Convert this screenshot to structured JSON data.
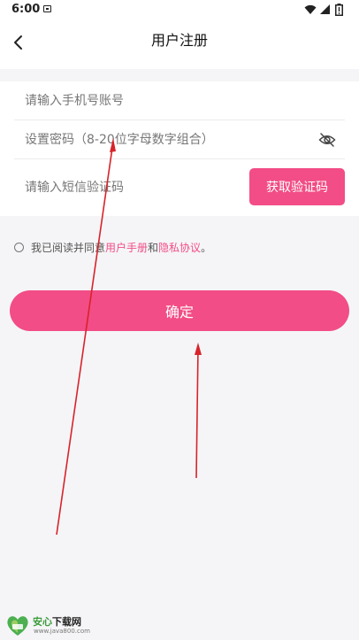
{
  "status_bar": {
    "time": "6:00",
    "icons": [
      "notification-icon",
      "wifi-icon",
      "signal-icon",
      "battery-icon"
    ]
  },
  "header": {
    "title": "用户注册",
    "back_icon": "chevron-left-icon"
  },
  "form": {
    "phone_placeholder": "请输入手机号账号",
    "password_placeholder": "设置密码（8-20位字母数字组合）",
    "password_visibility_icon": "eye-off-icon",
    "sms_placeholder": "请输入短信验证码",
    "get_code_label": "获取验证码"
  },
  "agreement": {
    "prefix": "我已阅读并同意",
    "user_manual": "用户手册",
    "and": "和",
    "privacy": "隐私协议",
    "suffix": "。"
  },
  "confirm_label": "确定",
  "watermark": {
    "name_a": "安心",
    "name_b": "下载网",
    "url": "www.java800.com"
  },
  "colors": {
    "accent": "#f24d86",
    "background": "#f5f5f7",
    "annotation": "#d8232a"
  }
}
